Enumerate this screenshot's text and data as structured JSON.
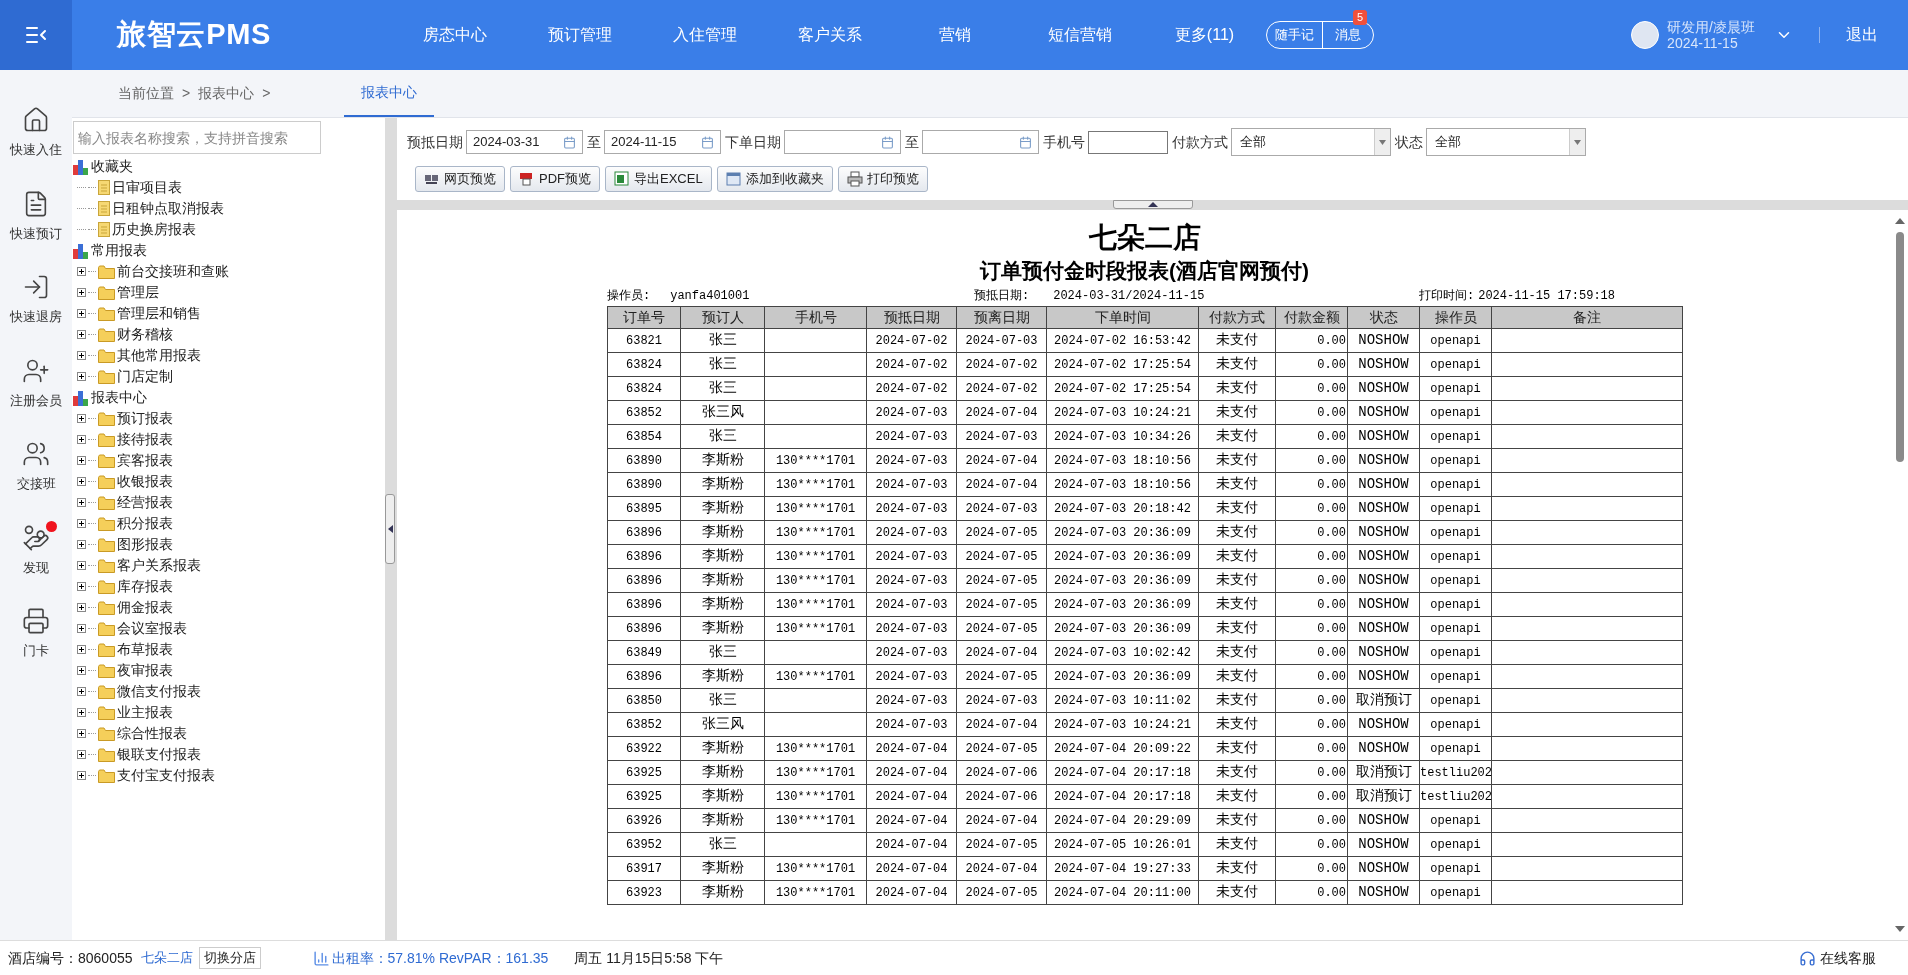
{
  "topbar": {
    "logo": "旅智云PMS",
    "nav": [
      {
        "label": "房态中心"
      },
      {
        "label": "预订管理"
      },
      {
        "label": "入住管理"
      },
      {
        "label": "客户关系"
      },
      {
        "label": "营销"
      },
      {
        "label": "短信营销"
      },
      {
        "label": "更多(11)"
      }
    ],
    "note_button": "随手记",
    "message_button": "消息",
    "message_badge": "5",
    "user": "研发用/凌晨班",
    "date": "2024-11-15",
    "logout": "退出"
  },
  "rail": [
    {
      "kind": "checkin",
      "label": "快速入住",
      "dot": false
    },
    {
      "kind": "booking",
      "label": "快速预订",
      "dot": false
    },
    {
      "kind": "checkout",
      "label": "快速退房",
      "dot": false
    },
    {
      "kind": "member",
      "label": "注册会员",
      "dot": false
    },
    {
      "kind": "shift",
      "label": "交接班",
      "dot": false
    },
    {
      "kind": "discover",
      "label": "发现",
      "dot": true
    },
    {
      "kind": "card",
      "label": "门卡",
      "dot": false
    }
  ],
  "breadcrumb": {
    "items": [
      "当前位置",
      ">",
      "报表中心",
      ">"
    ],
    "tabs": [
      {
        "label": "报表中心",
        "selected": true
      }
    ]
  },
  "tree": {
    "search": {
      "placeholder": "输入报表名称搜索，支持拼音搜索"
    },
    "groups": [
      {
        "label": "收藏夹",
        "children": [
          {
            "kind": "file",
            "label": "日审项目表"
          },
          {
            "kind": "file",
            "label": "日租钟点取消报表"
          },
          {
            "kind": "file",
            "label": "历史换房报表"
          }
        ]
      },
      {
        "label": "常用报表",
        "children": [
          {
            "kind": "folder",
            "label": "前台交接班和查账",
            "expanded": false
          },
          {
            "kind": "folder",
            "label": "管理层",
            "expanded": false
          },
          {
            "kind": "folder",
            "label": "管理层和销售",
            "expanded": false
          },
          {
            "kind": "folder",
            "label": "财务稽核",
            "expanded": false
          },
          {
            "kind": "folder",
            "label": "其他常用报表",
            "expanded": false
          },
          {
            "kind": "folder",
            "label": "门店定制",
            "expanded": false
          }
        ]
      },
      {
        "label": "报表中心",
        "children": [
          {
            "kind": "folder",
            "label": "预订报表",
            "expanded": false
          },
          {
            "kind": "folder",
            "label": "接待报表",
            "expanded": false
          },
          {
            "kind": "folder",
            "label": "宾客报表",
            "expanded": false
          },
          {
            "kind": "folder",
            "label": "收银报表",
            "expanded": false
          },
          {
            "kind": "folder",
            "label": "经营报表",
            "expanded": false
          },
          {
            "kind": "folder",
            "label": "积分报表",
            "expanded": false
          },
          {
            "kind": "folder",
            "label": "图形报表",
            "expanded": false
          },
          {
            "kind": "folder",
            "label": "客户关系报表",
            "expanded": false
          },
          {
            "kind": "folder",
            "label": "库存报表",
            "expanded": false
          },
          {
            "kind": "folder",
            "label": "佣金报表",
            "expanded": false
          },
          {
            "kind": "folder",
            "label": "会议室报表",
            "expanded": false
          },
          {
            "kind": "folder",
            "label": "布草报表",
            "expanded": false
          },
          {
            "kind": "folder",
            "label": "夜审报表",
            "expanded": false
          },
          {
            "kind": "folder",
            "label": "微信支付报表",
            "expanded": false
          },
          {
            "kind": "folder",
            "label": "业主报表",
            "expanded": false
          },
          {
            "kind": "folder",
            "label": "综合性报表",
            "expanded": false
          },
          {
            "kind": "folder",
            "label": "银联支付报表",
            "expanded": false
          },
          {
            "kind": "folder",
            "label": "支付宝支付报表",
            "expanded": false
          }
        ]
      }
    ]
  },
  "filters": [
    {
      "kind": "date",
      "label": "预抵日期",
      "value": "2024-03-31"
    },
    {
      "kind": "date",
      "label": "至",
      "value": "2024-11-15"
    },
    {
      "kind": "date",
      "label": "下单日期"
    },
    {
      "kind": "date",
      "label": "至"
    },
    {
      "kind": "text",
      "label": "手机号"
    },
    {
      "kind": "select",
      "label": "付款方式",
      "value": "全部"
    },
    {
      "kind": "select",
      "label": "状态",
      "value": "全部"
    }
  ],
  "actions": [
    {
      "kind": "web",
      "label": "网页预览"
    },
    {
      "kind": "pdf",
      "label": "PDF预览"
    },
    {
      "kind": "excel",
      "label": "导出EXCEL"
    },
    {
      "kind": "favorite",
      "label": "添加到收藏夹"
    },
    {
      "kind": "print",
      "label": "打印预览"
    }
  ],
  "report": {
    "hotel": "七朵二店",
    "title": "订单预付金时段报表(酒店官网预付)",
    "meta": [
      {
        "label": "操作员:",
        "value": "yanfa401001"
      },
      {
        "label": "预抵日期:",
        "value": "2024-03-31/2024-11-15"
      },
      {
        "label": "打印时间:",
        "value": "2024-11-15 17:59:18"
      }
    ],
    "columns": [
      "订单号",
      "预订人",
      "手机号",
      "预抵日期",
      "预离日期",
      "下单时间",
      "付款方式",
      "付款金额",
      "状态",
      "操作员",
      "备注"
    ],
    "rows": [
      {
        "order": "63821",
        "guest": "张三",
        "arrive": "2024-07-02",
        "depart": "2024-07-03",
        "ordered": "2024-07-02 16:53:42",
        "pay": "未支付",
        "amount": "0.00",
        "status": "NOSHOW",
        "operator": "openapi"
      },
      {
        "order": "63824",
        "guest": "张三",
        "arrive": "2024-07-02",
        "depart": "2024-07-02",
        "ordered": "2024-07-02 17:25:54",
        "pay": "未支付",
        "amount": "0.00",
        "status": "NOSHOW",
        "operator": "openapi"
      },
      {
        "order": "63824",
        "guest": "张三",
        "arrive": "2024-07-02",
        "depart": "2024-07-02",
        "ordered": "2024-07-02 17:25:54",
        "pay": "未支付",
        "amount": "0.00",
        "status": "NOSHOW",
        "operator": "openapi"
      },
      {
        "order": "63852",
        "guest": "张三风",
        "arrive": "2024-07-03",
        "depart": "2024-07-04",
        "ordered": "2024-07-03 10:24:21",
        "pay": "未支付",
        "amount": "0.00",
        "status": "NOSHOW",
        "operator": "openapi"
      },
      {
        "order": "63854",
        "guest": "张三",
        "arrive": "2024-07-03",
        "depart": "2024-07-03",
        "ordered": "2024-07-03 10:34:26",
        "pay": "未支付",
        "amount": "0.00",
        "status": "NOSHOW",
        "operator": "openapi"
      },
      {
        "order": "63890",
        "guest": "李斯粉",
        "phone": "130****1701",
        "arrive": "2024-07-03",
        "depart": "2024-07-04",
        "ordered": "2024-07-03 18:10:56",
        "pay": "未支付",
        "amount": "0.00",
        "status": "NOSHOW",
        "operator": "openapi"
      },
      {
        "order": "63890",
        "guest": "李斯粉",
        "phone": "130****1701",
        "arrive": "2024-07-03",
        "depart": "2024-07-04",
        "ordered": "2024-07-03 18:10:56",
        "pay": "未支付",
        "amount": "0.00",
        "status": "NOSHOW",
        "operator": "openapi"
      },
      {
        "order": "63895",
        "guest": "李斯粉",
        "phone": "130****1701",
        "arrive": "2024-07-03",
        "depart": "2024-07-03",
        "ordered": "2024-07-03 20:18:42",
        "pay": "未支付",
        "amount": "0.00",
        "status": "NOSHOW",
        "operator": "openapi"
      },
      {
        "order": "63896",
        "guest": "李斯粉",
        "phone": "130****1701",
        "arrive": "2024-07-03",
        "depart": "2024-07-05",
        "ordered": "2024-07-03 20:36:09",
        "pay": "未支付",
        "amount": "0.00",
        "status": "NOSHOW",
        "operator": "openapi"
      },
      {
        "order": "63896",
        "guest": "李斯粉",
        "phone": "130****1701",
        "arrive": "2024-07-03",
        "depart": "2024-07-05",
        "ordered": "2024-07-03 20:36:09",
        "pay": "未支付",
        "amount": "0.00",
        "status": "NOSHOW",
        "operator": "openapi"
      },
      {
        "order": "63896",
        "guest": "李斯粉",
        "phone": "130****1701",
        "arrive": "2024-07-03",
        "depart": "2024-07-05",
        "ordered": "2024-07-03 20:36:09",
        "pay": "未支付",
        "amount": "0.00",
        "status": "NOSHOW",
        "operator": "openapi"
      },
      {
        "order": "63896",
        "guest": "李斯粉",
        "phone": "130****1701",
        "arrive": "2024-07-03",
        "depart": "2024-07-05",
        "ordered": "2024-07-03 20:36:09",
        "pay": "未支付",
        "amount": "0.00",
        "status": "NOSHOW",
        "operator": "openapi"
      },
      {
        "order": "63896",
        "guest": "李斯粉",
        "phone": "130****1701",
        "arrive": "2024-07-03",
        "depart": "2024-07-05",
        "ordered": "2024-07-03 20:36:09",
        "pay": "未支付",
        "amount": "0.00",
        "status": "NOSHOW",
        "operator": "openapi"
      },
      {
        "order": "63849",
        "guest": "张三",
        "arrive": "2024-07-03",
        "depart": "2024-07-04",
        "ordered": "2024-07-03 10:02:42",
        "pay": "未支付",
        "amount": "0.00",
        "status": "NOSHOW",
        "operator": "openapi"
      },
      {
        "order": "63896",
        "guest": "李斯粉",
        "phone": "130****1701",
        "arrive": "2024-07-03",
        "depart": "2024-07-05",
        "ordered": "2024-07-03 20:36:09",
        "pay": "未支付",
        "amount": "0.00",
        "status": "NOSHOW",
        "operator": "openapi"
      },
      {
        "order": "63850",
        "guest": "张三",
        "arrive": "2024-07-03",
        "depart": "2024-07-03",
        "ordered": "2024-07-03 10:11:02",
        "pay": "未支付",
        "amount": "0.00",
        "status": "取消预订",
        "operator": "openapi"
      },
      {
        "order": "63852",
        "guest": "张三风",
        "arrive": "2024-07-03",
        "depart": "2024-07-04",
        "ordered": "2024-07-03 10:24:21",
        "pay": "未支付",
        "amount": "0.00",
        "status": "NOSHOW",
        "operator": "openapi"
      },
      {
        "order": "63922",
        "guest": "李斯粉",
        "phone": "130****1701",
        "arrive": "2024-07-04",
        "depart": "2024-07-05",
        "ordered": "2024-07-04 20:09:22",
        "pay": "未支付",
        "amount": "0.00",
        "status": "NOSHOW",
        "operator": "openapi"
      },
      {
        "order": "63925",
        "guest": "李斯粉",
        "phone": "130****1701",
        "arrive": "2024-07-04",
        "depart": "2024-07-06",
        "ordered": "2024-07-04 20:17:18",
        "pay": "未支付",
        "amount": "0.00",
        "status": "取消预订",
        "operator": "testliu202"
      },
      {
        "order": "63925",
        "guest": "李斯粉",
        "phone": "130****1701",
        "arrive": "2024-07-04",
        "depart": "2024-07-06",
        "ordered": "2024-07-04 20:17:18",
        "pay": "未支付",
        "amount": "0.00",
        "status": "取消预订",
        "operator": "testliu202"
      },
      {
        "order": "63926",
        "guest": "李斯粉",
        "phone": "130****1701",
        "arrive": "2024-07-04",
        "depart": "2024-07-04",
        "ordered": "2024-07-04 20:29:09",
        "pay": "未支付",
        "amount": "0.00",
        "status": "NOSHOW",
        "operator": "openapi"
      },
      {
        "order": "63952",
        "guest": "张三",
        "arrive": "2024-07-04",
        "depart": "2024-07-05",
        "ordered": "2024-07-05 10:26:01",
        "pay": "未支付",
        "amount": "0.00",
        "status": "NOSHOW",
        "operator": "openapi"
      },
      {
        "order": "63917",
        "guest": "李斯粉",
        "phone": "130****1701",
        "arrive": "2024-07-04",
        "depart": "2024-07-04",
        "ordered": "2024-07-04 19:27:33",
        "pay": "未支付",
        "amount": "0.00",
        "status": "NOSHOW",
        "operator": "openapi"
      },
      {
        "order": "63923",
        "guest": "李斯粉",
        "phone": "130****1701",
        "arrive": "2024-07-04",
        "depart": "2024-07-05",
        "ordered": "2024-07-04 20:11:00",
        "pay": "未支付",
        "amount": "0.00",
        "status": "NOSHOW",
        "operator": "openapi"
      }
    ]
  },
  "status_bar": {
    "hotel_label": "酒店编号：",
    "hotel_id": "8060055",
    "hotel_name": "七朵二店",
    "switch_button": "切换分店",
    "occupancy": "出租率：57.81% RevPAR：161.35",
    "datetime": "周五 11月15日5:58 下午",
    "support": "在线客服"
  }
}
